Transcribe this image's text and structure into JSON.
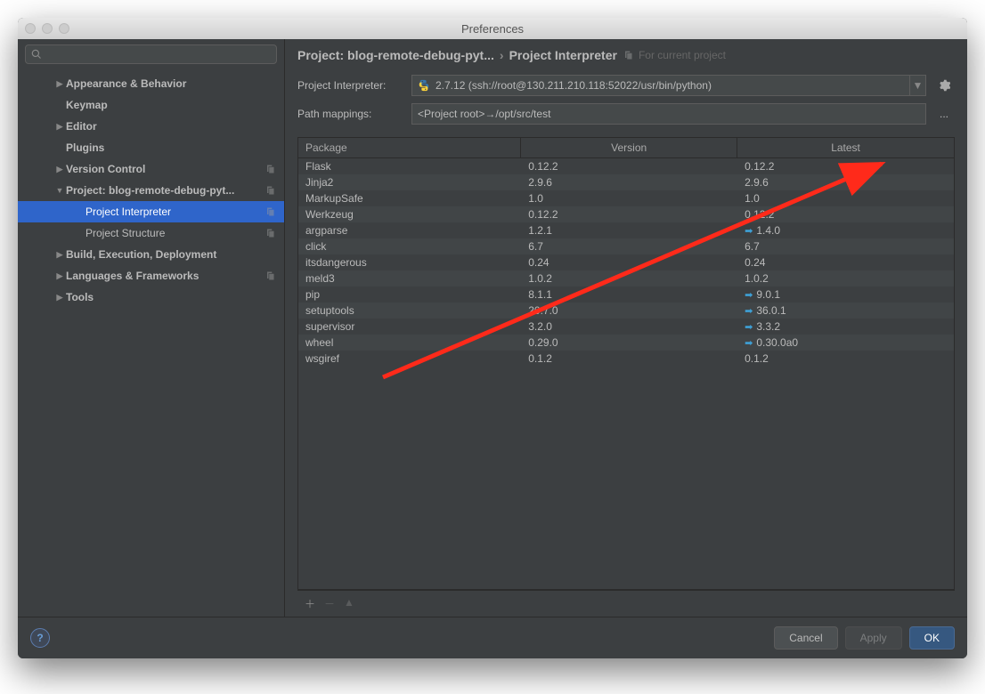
{
  "window": {
    "title": "Preferences"
  },
  "search": {
    "placeholder": ""
  },
  "sidebar": {
    "items": [
      {
        "label": "Appearance & Behavior",
        "expandable": true,
        "expanded": false,
        "indent": 0
      },
      {
        "label": "Keymap",
        "expandable": false,
        "indent": 0
      },
      {
        "label": "Editor",
        "expandable": true,
        "expanded": false,
        "indent": 0
      },
      {
        "label": "Plugins",
        "expandable": false,
        "indent": 0
      },
      {
        "label": "Version Control",
        "expandable": true,
        "expanded": false,
        "indent": 0,
        "badge": true
      },
      {
        "label": "Project: blog-remote-debug-pyt...",
        "expandable": true,
        "expanded": true,
        "indent": 0,
        "badge": true
      },
      {
        "label": "Project Interpreter",
        "expandable": false,
        "indent": 1,
        "selected": true,
        "badge": true,
        "nonbold": true
      },
      {
        "label": "Project Structure",
        "expandable": false,
        "indent": 1,
        "badge": true,
        "nonbold": true
      },
      {
        "label": "Build, Execution, Deployment",
        "expandable": true,
        "expanded": false,
        "indent": 0
      },
      {
        "label": "Languages & Frameworks",
        "expandable": true,
        "expanded": false,
        "indent": 0,
        "badge": true
      },
      {
        "label": "Tools",
        "expandable": true,
        "expanded": false,
        "indent": 0
      }
    ]
  },
  "breadcrumb": {
    "part1": "Project: blog-remote-debug-pyt...",
    "part2": "Project Interpreter",
    "badge": "For current project"
  },
  "form": {
    "interpreter_label": "Project Interpreter:",
    "interpreter_value": "2.7.12 (ssh://root@130.211.210.118:52022/usr/bin/python)",
    "path_label": "Path mappings:",
    "path_value": "<Project root>→/opt/src/test"
  },
  "table": {
    "headers": {
      "package": "Package",
      "version": "Version",
      "latest": "Latest"
    },
    "rows": [
      {
        "pkg": "Flask",
        "ver": "0.12.2",
        "lat": "0.12.2",
        "upd": false
      },
      {
        "pkg": "Jinja2",
        "ver": "2.9.6",
        "lat": "2.9.6",
        "upd": false
      },
      {
        "pkg": "MarkupSafe",
        "ver": "1.0",
        "lat": "1.0",
        "upd": false
      },
      {
        "pkg": "Werkzeug",
        "ver": "0.12.2",
        "lat": "0.12.2",
        "upd": false
      },
      {
        "pkg": "argparse",
        "ver": "1.2.1",
        "lat": "1.4.0",
        "upd": true
      },
      {
        "pkg": "click",
        "ver": "6.7",
        "lat": "6.7",
        "upd": false
      },
      {
        "pkg": "itsdangerous",
        "ver": "0.24",
        "lat": "0.24",
        "upd": false
      },
      {
        "pkg": "meld3",
        "ver": "1.0.2",
        "lat": "1.0.2",
        "upd": false
      },
      {
        "pkg": "pip",
        "ver": "8.1.1",
        "lat": "9.0.1",
        "upd": true
      },
      {
        "pkg": "setuptools",
        "ver": "20.7.0",
        "lat": "36.0.1",
        "upd": true
      },
      {
        "pkg": "supervisor",
        "ver": "3.2.0",
        "lat": "3.3.2",
        "upd": true
      },
      {
        "pkg": "wheel",
        "ver": "0.29.0",
        "lat": "0.30.0a0",
        "upd": true
      },
      {
        "pkg": "wsgiref",
        "ver": "0.1.2",
        "lat": "0.1.2",
        "upd": false
      }
    ]
  },
  "footer": {
    "cancel": "Cancel",
    "apply": "Apply",
    "ok": "OK"
  },
  "annotation": {
    "color": "#ff2a1a"
  }
}
